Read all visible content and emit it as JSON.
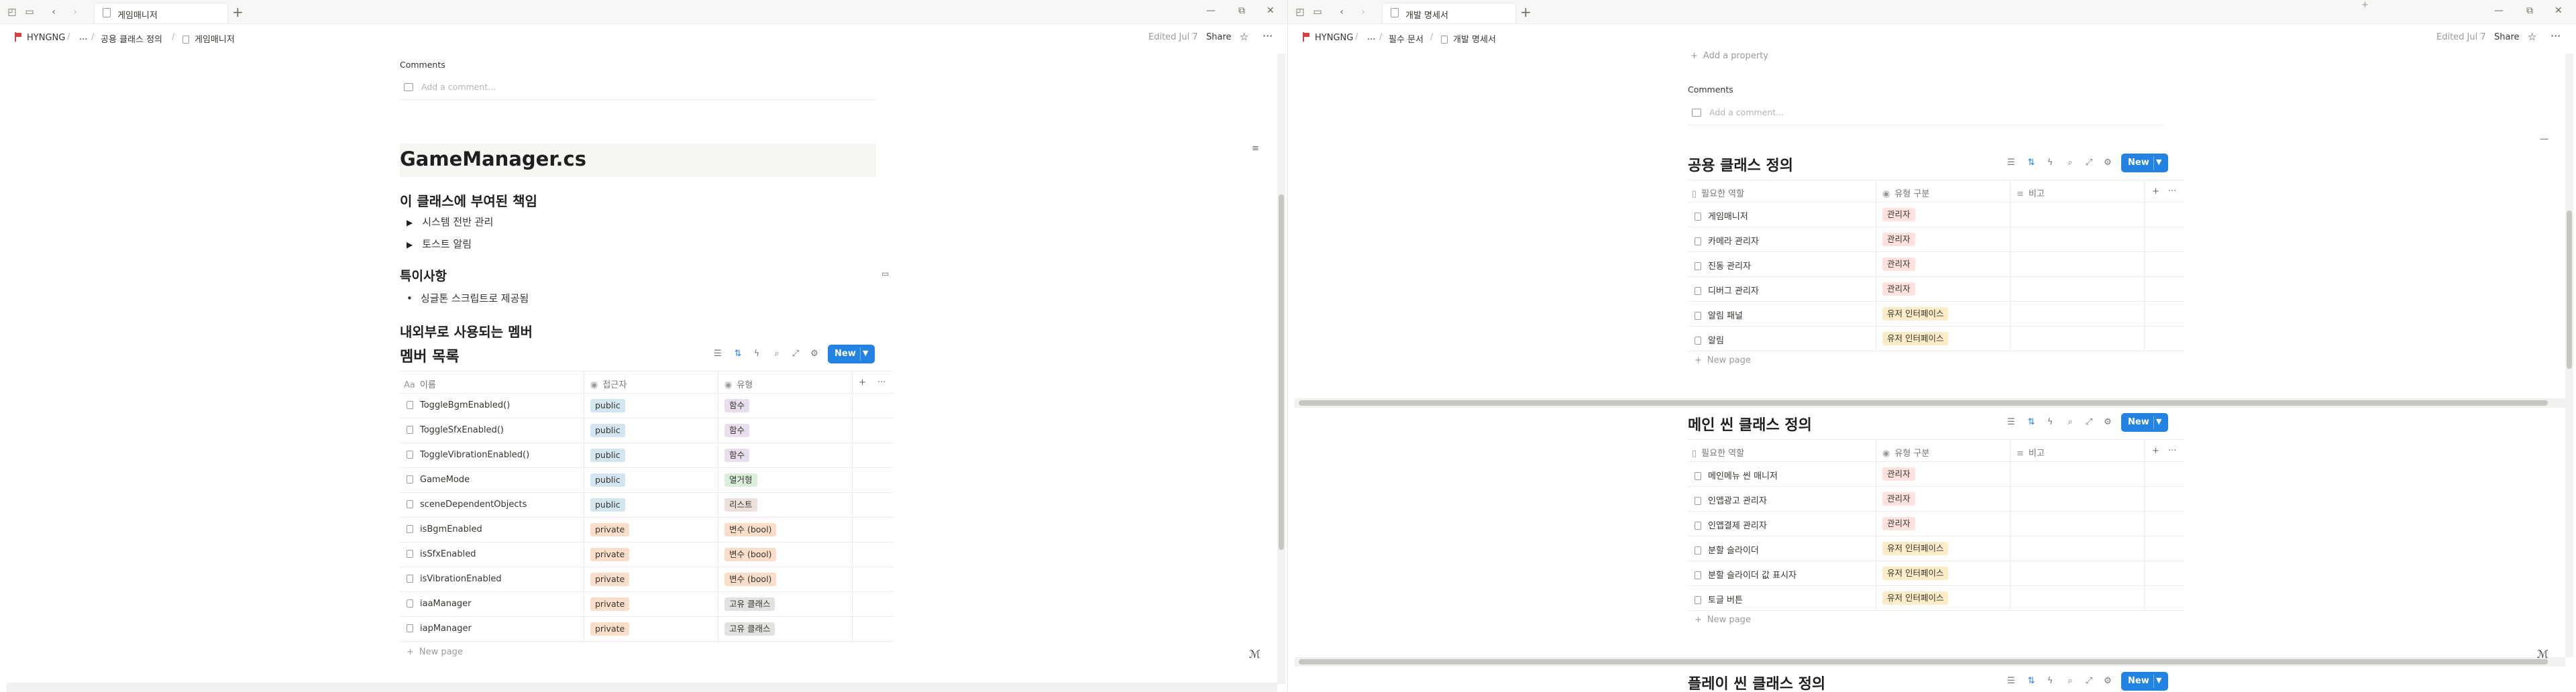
{
  "colors": {
    "accent": "#2383e2",
    "tag_public": "#d3e5ef",
    "tag_private": "#fadec9",
    "tag_func": "#e8deee",
    "tag_enum": "#dbeddb",
    "tag_list": "#eee0da",
    "tag_var": "#fadec9",
    "tag_class": "#e3e2e0",
    "tag_manager": "#ffe2dd",
    "tag_ui": "#fdecc8"
  },
  "left": {
    "tab_title": "게임매니저",
    "breadcrumb": {
      "root": "HYNGNG",
      "ellipsis": "...",
      "parent": "공용 클래스 정의",
      "current": "게임매니저"
    },
    "edited": "Edited Jul 7",
    "share": "Share",
    "comments_label": "Comments",
    "comment_placeholder": "Add a comment...",
    "page_title": "GameManager.cs",
    "h_resp": "이 클래스에 부여된 책임",
    "toggles": [
      "시스템 전반 관리",
      "토스트 알림"
    ],
    "h_notes": "특이사항",
    "bullets": [
      "싱글톤 스크립트로 제공됨"
    ],
    "h_members": "내외부로 사용되는 멤버",
    "db": {
      "title": "멤버 목록",
      "new_label": "New",
      "columns": [
        "이름",
        "접근자",
        "유형"
      ],
      "rows": [
        {
          "name": "ToggleBgmEnabled()",
          "access": "public",
          "type": "함수",
          "tone": "func"
        },
        {
          "name": "ToggleSfxEnabled()",
          "access": "public",
          "type": "함수",
          "tone": "func"
        },
        {
          "name": "ToggleVibrationEnabled()",
          "access": "public",
          "type": "함수",
          "tone": "func"
        },
        {
          "name": "GameMode",
          "access": "public",
          "type": "열거형",
          "tone": "enum"
        },
        {
          "name": "sceneDependentObjects",
          "access": "public",
          "type": "리스트",
          "tone": "list"
        },
        {
          "name": "isBgmEnabled",
          "access": "private",
          "type": "변수 (bool)",
          "tone": "var"
        },
        {
          "name": "isSfxEnabled",
          "access": "private",
          "type": "변수 (bool)",
          "tone": "var"
        },
        {
          "name": "isVibrationEnabled",
          "access": "private",
          "type": "변수 (bool)",
          "tone": "var"
        },
        {
          "name": "iaaManager",
          "access": "private",
          "type": "고유 클래스",
          "tone": "class"
        },
        {
          "name": "iapManager",
          "access": "private",
          "type": "고유 클래스",
          "tone": "class"
        }
      ],
      "new_page": "New page"
    }
  },
  "right": {
    "tab_title": "개발 명세서",
    "breadcrumb": {
      "root": "HYNGNG",
      "ellipsis": "...",
      "parent": "필수 문서",
      "current": "개발 명세서"
    },
    "edited": "Edited Jul 7",
    "share": "Share",
    "add_property": "Add a property",
    "comments_label": "Comments",
    "comment_placeholder": "Add a comment...",
    "db1": {
      "title": "공용 클래스 정의",
      "new_label": "New",
      "columns": [
        "필요한 역할",
        "유형 구분",
        "비고"
      ],
      "rows": [
        {
          "name": "게임매니저",
          "type": "관리자",
          "tone": "manager"
        },
        {
          "name": "카메라 관리자",
          "type": "관리자",
          "tone": "manager"
        },
        {
          "name": "진동 관리자",
          "type": "관리자",
          "tone": "manager"
        },
        {
          "name": "디버그 관리자",
          "type": "관리자",
          "tone": "manager"
        },
        {
          "name": "알림 패널",
          "type": "유저 인터페이스",
          "tone": "ui"
        },
        {
          "name": "알림",
          "type": "유저 인터페이스",
          "tone": "ui"
        }
      ],
      "new_page": "New page"
    },
    "db2": {
      "title": "메인 씬 클래스 정의",
      "new_label": "New",
      "columns": [
        "필요한 역할",
        "유형 구분",
        "비고"
      ],
      "rows": [
        {
          "name": "메인메뉴 씬 매니저",
          "type": "관리자",
          "tone": "manager"
        },
        {
          "name": "인앱광고 관리자",
          "type": "관리자",
          "tone": "manager"
        },
        {
          "name": "인앱결제 관리자",
          "type": "관리자",
          "tone": "manager"
        },
        {
          "name": "분할 슬라이더",
          "type": "유저 인터페이스",
          "tone": "ui"
        },
        {
          "name": "분할 슬라이더 값 표시자",
          "type": "유저 인터페이스",
          "tone": "ui"
        },
        {
          "name": "토글 버튼",
          "type": "유저 인터페이스",
          "tone": "ui"
        }
      ],
      "new_page": "New page"
    },
    "db3": {
      "title": "플레이 씬 클래스 정의",
      "new_label": "New"
    }
  }
}
